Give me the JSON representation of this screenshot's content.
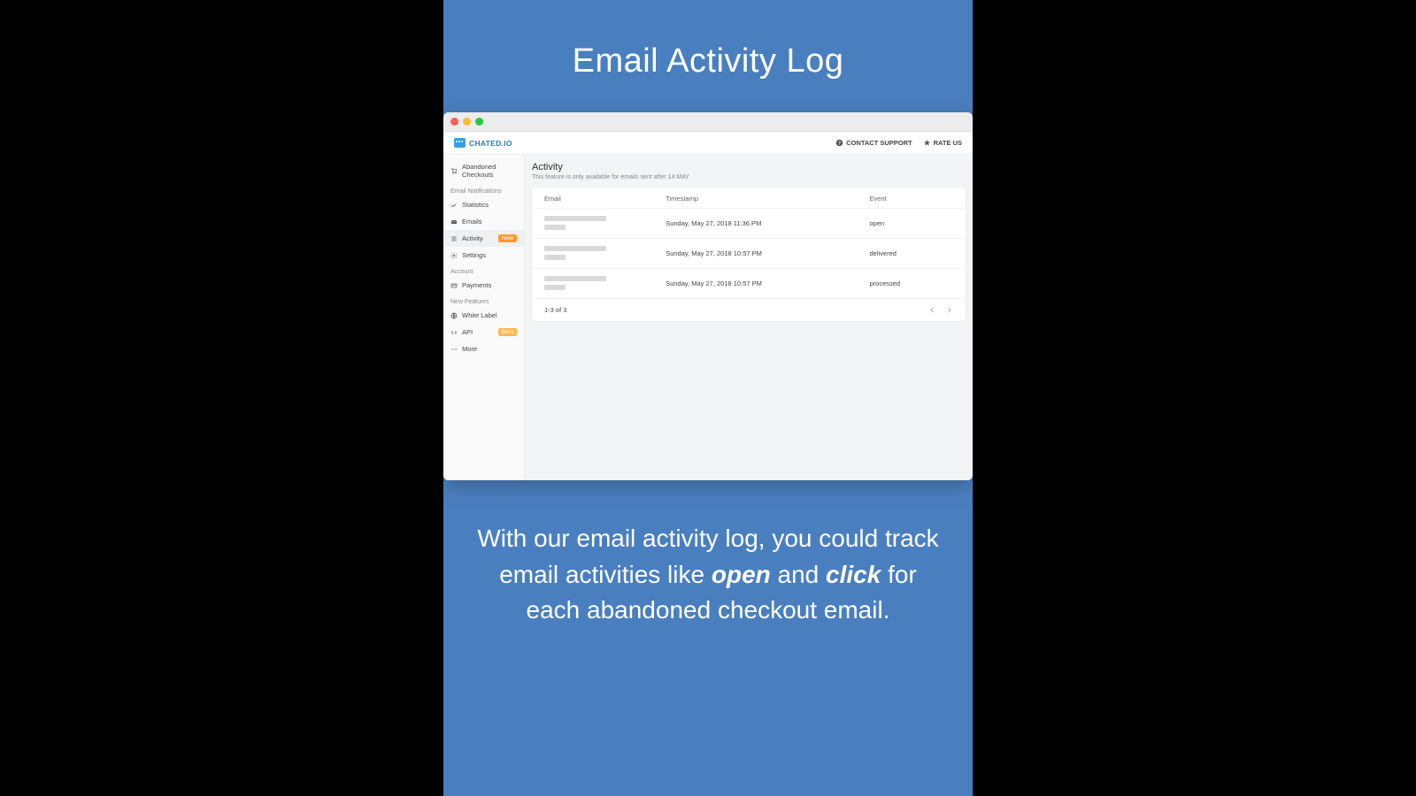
{
  "promo": {
    "title": "Email Activity Log",
    "desc_pre": "With our email activity log, you could track email activities like ",
    "desc_em1": "open",
    "desc_mid": " and ",
    "desc_em2": "click",
    "desc_post": " for each abandoned checkout email."
  },
  "brand": {
    "name": "CHATED.IO"
  },
  "topbar": {
    "contact": "CONTACT SUPPORT",
    "rate": "RATE US"
  },
  "sidebar": {
    "abandoned": "Abandoned Checkouts",
    "h_email": "Email Notifications",
    "statistics": "Statistics",
    "emails": "Emails",
    "activity": "Activity",
    "activity_badge": "New",
    "settings": "Settings",
    "h_account": "Account",
    "payments": "Payments",
    "h_features": "New Features",
    "whitelabel": "White Label",
    "api": "API",
    "api_badge": "Beta",
    "more": "More"
  },
  "page": {
    "title": "Activity",
    "subtitle": "This feature is only available for emails sent after 14 MAY"
  },
  "table": {
    "col_email": "Email",
    "col_ts": "Timestamp",
    "col_event": "Event",
    "rows": [
      {
        "ts": "Sunday, May 27, 2018 11:36 PM",
        "event": "open"
      },
      {
        "ts": "Sunday, May 27, 2018 10:57 PM",
        "event": "delivered"
      },
      {
        "ts": "Sunday, May 27, 2018 10:57 PM",
        "event": "processed"
      }
    ],
    "pager": "1-3 of 3"
  }
}
